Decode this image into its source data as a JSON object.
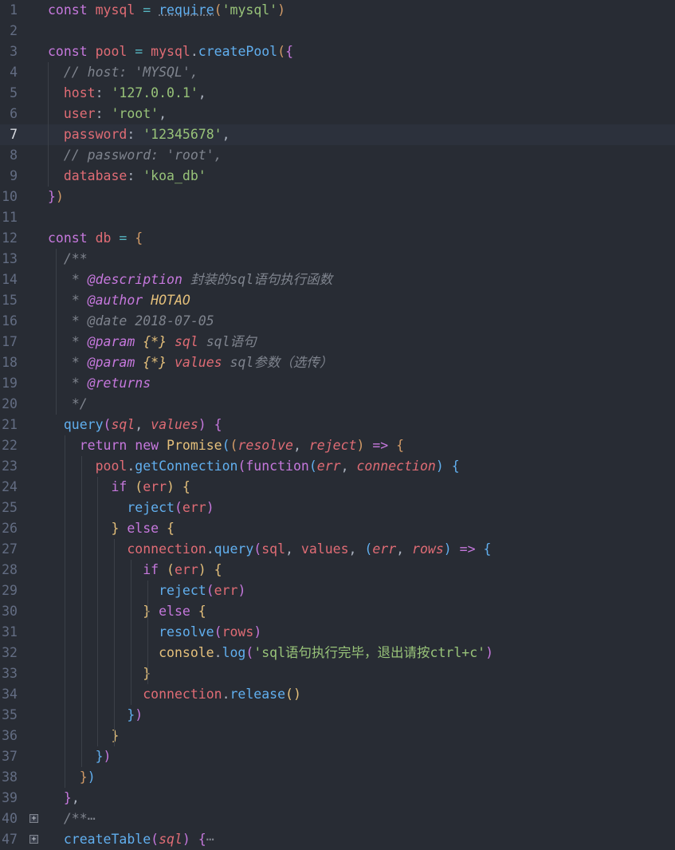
{
  "editor": {
    "language": "javascript",
    "theme": "one-dark",
    "active_line": "7",
    "lines": [
      {
        "n": "1",
        "tokens": [
          [
            "kw",
            "const "
          ],
          [
            "var",
            "mysql"
          ],
          [
            "plain",
            " "
          ],
          [
            "op",
            "="
          ],
          [
            "plain",
            " "
          ],
          [
            "fn",
            "require"
          ],
          [
            "p1",
            "("
          ],
          [
            "str",
            "'mysql'"
          ],
          [
            "p1",
            ")"
          ]
        ]
      },
      {
        "n": "2",
        "tokens": []
      },
      {
        "n": "3",
        "tokens": [
          [
            "kw",
            "const "
          ],
          [
            "var",
            "pool"
          ],
          [
            "plain",
            " "
          ],
          [
            "op",
            "="
          ],
          [
            "plain",
            " "
          ],
          [
            "var",
            "mysql"
          ],
          [
            "plain",
            "."
          ],
          [
            "fn",
            "createPool"
          ],
          [
            "p1",
            "("
          ],
          [
            "p2",
            "{"
          ]
        ]
      },
      {
        "n": "4",
        "tokens": [
          [
            "plain",
            "  "
          ],
          [
            "cmt",
            "// host: 'MYSQL',"
          ]
        ]
      },
      {
        "n": "5",
        "tokens": [
          [
            "plain",
            "  "
          ],
          [
            "var",
            "host"
          ],
          [
            "plain",
            ": "
          ],
          [
            "str",
            "'127.0.0.1'"
          ],
          [
            "plain",
            ","
          ]
        ]
      },
      {
        "n": "6",
        "tokens": [
          [
            "plain",
            "  "
          ],
          [
            "var",
            "user"
          ],
          [
            "plain",
            ": "
          ],
          [
            "str",
            "'root'"
          ],
          [
            "plain",
            ","
          ]
        ]
      },
      {
        "n": "7",
        "tokens": [
          [
            "plain",
            "  "
          ],
          [
            "var",
            "password"
          ],
          [
            "plain",
            ": "
          ],
          [
            "str",
            "'12345678'"
          ],
          [
            "plain",
            ","
          ]
        ]
      },
      {
        "n": "8",
        "tokens": [
          [
            "plain",
            "  "
          ],
          [
            "cmt",
            "// password: 'root',"
          ]
        ]
      },
      {
        "n": "9",
        "tokens": [
          [
            "plain",
            "  "
          ],
          [
            "var",
            "database"
          ],
          [
            "plain",
            ": "
          ],
          [
            "str",
            "'koa_db'"
          ]
        ]
      },
      {
        "n": "10",
        "tokens": [
          [
            "p2",
            "}"
          ],
          [
            "p1",
            ")"
          ]
        ]
      },
      {
        "n": "11",
        "tokens": []
      },
      {
        "n": "12",
        "tokens": [
          [
            "kw",
            "const "
          ],
          [
            "var",
            "db"
          ],
          [
            "plain",
            " "
          ],
          [
            "op",
            "="
          ],
          [
            "plain",
            " "
          ],
          [
            "p1",
            "{"
          ]
        ]
      },
      {
        "n": "13",
        "tokens": [
          [
            "plain",
            "  "
          ],
          [
            "cmt",
            "/**"
          ]
        ]
      },
      {
        "n": "14",
        "tokens": [
          [
            "plain",
            "   "
          ],
          [
            "cmt",
            "* "
          ],
          [
            "tag",
            "@description"
          ],
          [
            "cmt",
            " 封装的sql语句执行函数"
          ]
        ]
      },
      {
        "n": "15",
        "tokens": [
          [
            "plain",
            "   "
          ],
          [
            "cmt",
            "* "
          ],
          [
            "tag",
            "@author"
          ],
          [
            "type",
            " HOTAO"
          ]
        ]
      },
      {
        "n": "16",
        "tokens": [
          [
            "plain",
            "   "
          ],
          [
            "cmt",
            "* @date 2018-07-05"
          ]
        ]
      },
      {
        "n": "17",
        "tokens": [
          [
            "plain",
            "   "
          ],
          [
            "cmt",
            "* "
          ],
          [
            "tag",
            "@param"
          ],
          [
            "type",
            " {*}"
          ],
          [
            "pname",
            " sql"
          ],
          [
            "cmt",
            " sql语句"
          ]
        ]
      },
      {
        "n": "18",
        "tokens": [
          [
            "plain",
            "   "
          ],
          [
            "cmt",
            "* "
          ],
          [
            "tag",
            "@param"
          ],
          [
            "type",
            " {*}"
          ],
          [
            "pname",
            " values"
          ],
          [
            "cmt",
            " sql参数（选传）"
          ]
        ]
      },
      {
        "n": "19",
        "tokens": [
          [
            "plain",
            "   "
          ],
          [
            "cmt",
            "* "
          ],
          [
            "tag",
            "@returns"
          ]
        ]
      },
      {
        "n": "20",
        "tokens": [
          [
            "plain",
            "   "
          ],
          [
            "cmt",
            "*/"
          ]
        ]
      },
      {
        "n": "21",
        "tokens": [
          [
            "plain",
            "  "
          ],
          [
            "fn",
            "query"
          ],
          [
            "p2",
            "("
          ],
          [
            "param",
            "sql"
          ],
          [
            "plain",
            ", "
          ],
          [
            "param",
            "values"
          ],
          [
            "p2",
            ")"
          ],
          [
            "plain",
            " "
          ],
          [
            "p2",
            "{"
          ]
        ]
      },
      {
        "n": "22",
        "tokens": [
          [
            "plain",
            "    "
          ],
          [
            "kw",
            "return new "
          ],
          [
            "cls",
            "Promise"
          ],
          [
            "p3",
            "("
          ],
          [
            "p1",
            "("
          ],
          [
            "param",
            "resolve"
          ],
          [
            "plain",
            ", "
          ],
          [
            "param",
            "reject"
          ],
          [
            "p1",
            ")"
          ],
          [
            "plain",
            " "
          ],
          [
            "kw",
            "=>"
          ],
          [
            "plain",
            " "
          ],
          [
            "p1",
            "{"
          ]
        ]
      },
      {
        "n": "23",
        "tokens": [
          [
            "plain",
            "      "
          ],
          [
            "var",
            "pool"
          ],
          [
            "plain",
            "."
          ],
          [
            "fn",
            "getConnection"
          ],
          [
            "p2",
            "("
          ],
          [
            "kw",
            "function"
          ],
          [
            "p3",
            "("
          ],
          [
            "param",
            "err"
          ],
          [
            "plain",
            ", "
          ],
          [
            "param",
            "connection"
          ],
          [
            "p3",
            ")"
          ],
          [
            "plain",
            " "
          ],
          [
            "p3",
            "{"
          ]
        ]
      },
      {
        "n": "24",
        "tokens": [
          [
            "plain",
            "        "
          ],
          [
            "kw",
            "if"
          ],
          [
            "plain",
            " "
          ],
          [
            "p4",
            "("
          ],
          [
            "var",
            "err"
          ],
          [
            "p4",
            ")"
          ],
          [
            "plain",
            " "
          ],
          [
            "p4",
            "{"
          ]
        ]
      },
      {
        "n": "25",
        "tokens": [
          [
            "plain",
            "          "
          ],
          [
            "fn",
            "reject"
          ],
          [
            "p2",
            "("
          ],
          [
            "var",
            "err"
          ],
          [
            "p2",
            ")"
          ]
        ]
      },
      {
        "n": "26",
        "tokens": [
          [
            "plain",
            "        "
          ],
          [
            "p4",
            "}"
          ],
          [
            "plain",
            " "
          ],
          [
            "kw",
            "else"
          ],
          [
            "plain",
            " "
          ],
          [
            "p4",
            "{"
          ]
        ]
      },
      {
        "n": "27",
        "tokens": [
          [
            "plain",
            "          "
          ],
          [
            "var",
            "connection"
          ],
          [
            "plain",
            "."
          ],
          [
            "fn",
            "query"
          ],
          [
            "p2",
            "("
          ],
          [
            "var",
            "sql"
          ],
          [
            "plain",
            ", "
          ],
          [
            "var",
            "values"
          ],
          [
            "plain",
            ", "
          ],
          [
            "p3",
            "("
          ],
          [
            "param",
            "err"
          ],
          [
            "plain",
            ", "
          ],
          [
            "param",
            "rows"
          ],
          [
            "p3",
            ")"
          ],
          [
            "plain",
            " "
          ],
          [
            "kw",
            "=>"
          ],
          [
            "plain",
            " "
          ],
          [
            "p3",
            "{"
          ]
        ]
      },
      {
        "n": "28",
        "tokens": [
          [
            "plain",
            "            "
          ],
          [
            "kw",
            "if"
          ],
          [
            "plain",
            " "
          ],
          [
            "p4",
            "("
          ],
          [
            "var",
            "err"
          ],
          [
            "p4",
            ")"
          ],
          [
            "plain",
            " "
          ],
          [
            "p4",
            "{"
          ]
        ]
      },
      {
        "n": "29",
        "tokens": [
          [
            "plain",
            "              "
          ],
          [
            "fn",
            "reject"
          ],
          [
            "p2",
            "("
          ],
          [
            "var",
            "err"
          ],
          [
            "p2",
            ")"
          ]
        ]
      },
      {
        "n": "30",
        "tokens": [
          [
            "plain",
            "            "
          ],
          [
            "p4",
            "}"
          ],
          [
            "plain",
            " "
          ],
          [
            "kw",
            "else"
          ],
          [
            "plain",
            " "
          ],
          [
            "p4",
            "{"
          ]
        ]
      },
      {
        "n": "31",
        "tokens": [
          [
            "plain",
            "              "
          ],
          [
            "fn",
            "resolve"
          ],
          [
            "p2",
            "("
          ],
          [
            "var",
            "rows"
          ],
          [
            "p2",
            ")"
          ]
        ]
      },
      {
        "n": "32",
        "tokens": [
          [
            "plain",
            "              "
          ],
          [
            "obj",
            "console"
          ],
          [
            "plain",
            "."
          ],
          [
            "fn",
            "log"
          ],
          [
            "p2",
            "("
          ],
          [
            "str",
            "'sql语句执行完毕，退出请按ctrl+c'"
          ],
          [
            "p2",
            ")"
          ]
        ]
      },
      {
        "n": "33",
        "tokens": [
          [
            "plain",
            "            "
          ],
          [
            "p4",
            "}"
          ]
        ]
      },
      {
        "n": "34",
        "tokens": [
          [
            "plain",
            "            "
          ],
          [
            "var",
            "connection"
          ],
          [
            "plain",
            "."
          ],
          [
            "fn",
            "release"
          ],
          [
            "p4",
            "()"
          ]
        ]
      },
      {
        "n": "35",
        "tokens": [
          [
            "plain",
            "          "
          ],
          [
            "p3",
            "}"
          ],
          [
            "p2",
            ")"
          ]
        ]
      },
      {
        "n": "36",
        "tokens": [
          [
            "plain",
            "        "
          ],
          [
            "p4",
            "}"
          ]
        ]
      },
      {
        "n": "37",
        "tokens": [
          [
            "plain",
            "      "
          ],
          [
            "p3",
            "}"
          ],
          [
            "p2",
            ")"
          ]
        ]
      },
      {
        "n": "38",
        "tokens": [
          [
            "plain",
            "    "
          ],
          [
            "p1",
            "}"
          ],
          [
            "p3",
            ")"
          ]
        ]
      },
      {
        "n": "39",
        "tokens": [
          [
            "plain",
            "  "
          ],
          [
            "p2",
            "}"
          ],
          [
            "plain",
            ","
          ]
        ]
      },
      {
        "n": "40",
        "fold": true,
        "tokens": [
          [
            "plain",
            "  "
          ],
          [
            "cmt",
            "/**"
          ],
          [
            "ell",
            "⋯"
          ]
        ]
      },
      {
        "n": "47",
        "fold": true,
        "tokens": [
          [
            "plain",
            "  "
          ],
          [
            "fn",
            "createTable"
          ],
          [
            "p2",
            "("
          ],
          [
            "param",
            "sql"
          ],
          [
            "p2",
            ")"
          ],
          [
            "plain",
            " "
          ],
          [
            "p2",
            "{"
          ],
          [
            "ell",
            "⋯"
          ]
        ]
      }
    ]
  }
}
